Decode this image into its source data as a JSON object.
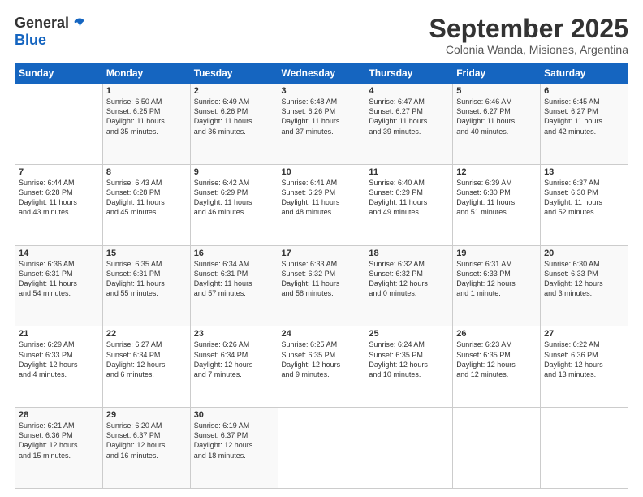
{
  "logo": {
    "general": "General",
    "blue": "Blue"
  },
  "title": "September 2025",
  "subtitle": "Colonia Wanda, Misiones, Argentina",
  "headers": [
    "Sunday",
    "Monday",
    "Tuesday",
    "Wednesday",
    "Thursday",
    "Friday",
    "Saturday"
  ],
  "weeks": [
    [
      {
        "day": "",
        "text": ""
      },
      {
        "day": "1",
        "text": "Sunrise: 6:50 AM\nSunset: 6:25 PM\nDaylight: 11 hours\nand 35 minutes."
      },
      {
        "day": "2",
        "text": "Sunrise: 6:49 AM\nSunset: 6:26 PM\nDaylight: 11 hours\nand 36 minutes."
      },
      {
        "day": "3",
        "text": "Sunrise: 6:48 AM\nSunset: 6:26 PM\nDaylight: 11 hours\nand 37 minutes."
      },
      {
        "day": "4",
        "text": "Sunrise: 6:47 AM\nSunset: 6:27 PM\nDaylight: 11 hours\nand 39 minutes."
      },
      {
        "day": "5",
        "text": "Sunrise: 6:46 AM\nSunset: 6:27 PM\nDaylight: 11 hours\nand 40 minutes."
      },
      {
        "day": "6",
        "text": "Sunrise: 6:45 AM\nSunset: 6:27 PM\nDaylight: 11 hours\nand 42 minutes."
      }
    ],
    [
      {
        "day": "7",
        "text": "Sunrise: 6:44 AM\nSunset: 6:28 PM\nDaylight: 11 hours\nand 43 minutes."
      },
      {
        "day": "8",
        "text": "Sunrise: 6:43 AM\nSunset: 6:28 PM\nDaylight: 11 hours\nand 45 minutes."
      },
      {
        "day": "9",
        "text": "Sunrise: 6:42 AM\nSunset: 6:29 PM\nDaylight: 11 hours\nand 46 minutes."
      },
      {
        "day": "10",
        "text": "Sunrise: 6:41 AM\nSunset: 6:29 PM\nDaylight: 11 hours\nand 48 minutes."
      },
      {
        "day": "11",
        "text": "Sunrise: 6:40 AM\nSunset: 6:29 PM\nDaylight: 11 hours\nand 49 minutes."
      },
      {
        "day": "12",
        "text": "Sunrise: 6:39 AM\nSunset: 6:30 PM\nDaylight: 11 hours\nand 51 minutes."
      },
      {
        "day": "13",
        "text": "Sunrise: 6:37 AM\nSunset: 6:30 PM\nDaylight: 11 hours\nand 52 minutes."
      }
    ],
    [
      {
        "day": "14",
        "text": "Sunrise: 6:36 AM\nSunset: 6:31 PM\nDaylight: 11 hours\nand 54 minutes."
      },
      {
        "day": "15",
        "text": "Sunrise: 6:35 AM\nSunset: 6:31 PM\nDaylight: 11 hours\nand 55 minutes."
      },
      {
        "day": "16",
        "text": "Sunrise: 6:34 AM\nSunset: 6:31 PM\nDaylight: 11 hours\nand 57 minutes."
      },
      {
        "day": "17",
        "text": "Sunrise: 6:33 AM\nSunset: 6:32 PM\nDaylight: 11 hours\nand 58 minutes."
      },
      {
        "day": "18",
        "text": "Sunrise: 6:32 AM\nSunset: 6:32 PM\nDaylight: 12 hours\nand 0 minutes."
      },
      {
        "day": "19",
        "text": "Sunrise: 6:31 AM\nSunset: 6:33 PM\nDaylight: 12 hours\nand 1 minute."
      },
      {
        "day": "20",
        "text": "Sunrise: 6:30 AM\nSunset: 6:33 PM\nDaylight: 12 hours\nand 3 minutes."
      }
    ],
    [
      {
        "day": "21",
        "text": "Sunrise: 6:29 AM\nSunset: 6:33 PM\nDaylight: 12 hours\nand 4 minutes."
      },
      {
        "day": "22",
        "text": "Sunrise: 6:27 AM\nSunset: 6:34 PM\nDaylight: 12 hours\nand 6 minutes."
      },
      {
        "day": "23",
        "text": "Sunrise: 6:26 AM\nSunset: 6:34 PM\nDaylight: 12 hours\nand 7 minutes."
      },
      {
        "day": "24",
        "text": "Sunrise: 6:25 AM\nSunset: 6:35 PM\nDaylight: 12 hours\nand 9 minutes."
      },
      {
        "day": "25",
        "text": "Sunrise: 6:24 AM\nSunset: 6:35 PM\nDaylight: 12 hours\nand 10 minutes."
      },
      {
        "day": "26",
        "text": "Sunrise: 6:23 AM\nSunset: 6:35 PM\nDaylight: 12 hours\nand 12 minutes."
      },
      {
        "day": "27",
        "text": "Sunrise: 6:22 AM\nSunset: 6:36 PM\nDaylight: 12 hours\nand 13 minutes."
      }
    ],
    [
      {
        "day": "28",
        "text": "Sunrise: 6:21 AM\nSunset: 6:36 PM\nDaylight: 12 hours\nand 15 minutes."
      },
      {
        "day": "29",
        "text": "Sunrise: 6:20 AM\nSunset: 6:37 PM\nDaylight: 12 hours\nand 16 minutes."
      },
      {
        "day": "30",
        "text": "Sunrise: 6:19 AM\nSunset: 6:37 PM\nDaylight: 12 hours\nand 18 minutes."
      },
      {
        "day": "",
        "text": ""
      },
      {
        "day": "",
        "text": ""
      },
      {
        "day": "",
        "text": ""
      },
      {
        "day": "",
        "text": ""
      }
    ]
  ]
}
